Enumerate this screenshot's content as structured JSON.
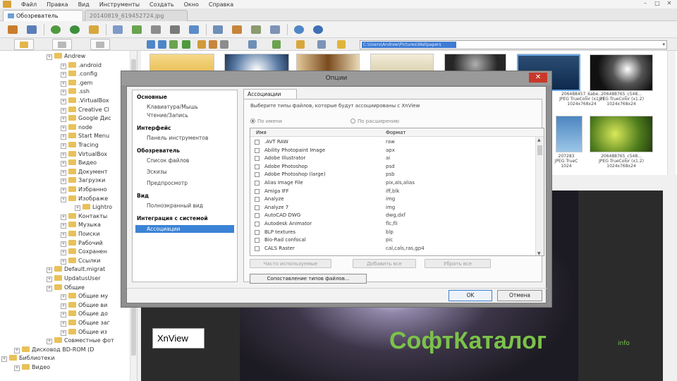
{
  "menubar": {
    "items": [
      "Файл",
      "Правка",
      "Вид",
      "Инструменты",
      "Создать",
      "Окно",
      "Справка"
    ],
    "window_buttons": [
      "–",
      "□",
      "✕"
    ]
  },
  "tabs": [
    {
      "label": "Обозреватель",
      "active": true
    },
    {
      "label": "20140819_619452724.jpg",
      "active": false
    }
  ],
  "address": {
    "value": "C:\\Users\\Andrew\\Pictures\\Wallpapers"
  },
  "tree": {
    "items": [
      {
        "label": "Andrew",
        "level": 0
      },
      {
        "label": ".android",
        "level": 1
      },
      {
        "label": ".config",
        "level": 1
      },
      {
        "label": ".gem",
        "level": 1
      },
      {
        "label": ".ssh",
        "level": 1
      },
      {
        "label": ".VirtualBox",
        "level": 1
      },
      {
        "label": "Creative Cl",
        "level": 1
      },
      {
        "label": "Google Дис",
        "level": 1
      },
      {
        "label": "node",
        "level": 1
      },
      {
        "label": "Start Menu",
        "level": 1
      },
      {
        "label": "Tracing",
        "level": 1
      },
      {
        "label": "VirtualBox",
        "level": 1
      },
      {
        "label": "Видео",
        "level": 1
      },
      {
        "label": "Документ",
        "level": 1
      },
      {
        "label": "Загрузки",
        "level": 1
      },
      {
        "label": "Избранно",
        "level": 1
      },
      {
        "label": "Изображе",
        "level": 1
      },
      {
        "label": "Lightro",
        "level": 2
      },
      {
        "label": "Контакты",
        "level": 1
      },
      {
        "label": "Музыка",
        "level": 1
      },
      {
        "label": "Поиски",
        "level": 1
      },
      {
        "label": "Рабочий",
        "level": 1
      },
      {
        "label": "Сохранен",
        "level": 1
      },
      {
        "label": "Ссылки",
        "level": 1
      },
      {
        "label": "Default.migrat",
        "level": 0
      },
      {
        "label": "UpdatusUser",
        "level": 0
      },
      {
        "label": "Общие",
        "level": 0
      },
      {
        "label": "Общие му",
        "level": 1
      },
      {
        "label": "Общие ви",
        "level": 1
      },
      {
        "label": "Общие до",
        "level": 1
      },
      {
        "label": "Общие заг",
        "level": 1
      },
      {
        "label": "Общие из",
        "level": 1
      },
      {
        "label": "Совместные фот",
        "level": 0
      },
      {
        "label": "Дисковод BD-ROM (D",
        "level": -1
      },
      {
        "label": "Библиотеки",
        "level": -2
      },
      {
        "label": "Видео",
        "level": -1
      }
    ]
  },
  "thumbnails": {
    "captions": [
      {
        "line1": "206488457_6abe...",
        "line2": "JPEG TrueColor (x1.2)",
        "line3": "1024x768x24"
      },
      {
        "line1": "206488765_c548...",
        "line2": "JPEG TrueColor (x1.2)",
        "line3": "1024x768x24"
      },
      {
        "line1": "207283",
        "line2": "JPEG TrueC",
        "line3": "1024"
      },
      {
        "line1": "20728",
        "line2": "JPEG TrueC",
        "line3": "1024"
      }
    ]
  },
  "dialog": {
    "title": "Опции",
    "close": "✕",
    "nav": [
      {
        "label": "Основные",
        "kind": "head"
      },
      {
        "label": "Клавиатура/Мышь",
        "kind": "sub"
      },
      {
        "label": "Чтение/Запись",
        "kind": "sub"
      },
      {
        "label": "Интерфейс",
        "kind": "head"
      },
      {
        "label": "Панель инструментов",
        "kind": "sub"
      },
      {
        "label": "Обозреватель",
        "kind": "head"
      },
      {
        "label": "Список файлов",
        "kind": "sub"
      },
      {
        "label": "Эскизы",
        "kind": "sub"
      },
      {
        "label": "Предпросмотр",
        "kind": "sub"
      },
      {
        "label": "Вид",
        "kind": "head"
      },
      {
        "label": "Полноэкранный вид",
        "kind": "sub"
      },
      {
        "label": "Интеграция с системой",
        "kind": "head"
      },
      {
        "label": "Ассоциации",
        "kind": "selected"
      }
    ],
    "tab_label": "Ассоциации",
    "hint": "Выберите типы файлов, которые будут ассоциированы с XnView",
    "radio_by_name": "По имени",
    "radio_by_ext": "По расширению",
    "col_name": "Имя",
    "col_format": "Формат",
    "rows": [
      {
        "name": ".AVT RAW",
        "format": "raw"
      },
      {
        "name": "Ability Photopaint Image",
        "format": "apx"
      },
      {
        "name": "Adobe Illustrator",
        "format": "ai"
      },
      {
        "name": "Adobe Photoshop",
        "format": "psd"
      },
      {
        "name": "Adobe Photoshop (large)",
        "format": "psb"
      },
      {
        "name": "Alias Image File",
        "format": "pix,als,alias"
      },
      {
        "name": "Amiga IFF",
        "format": "iff,blk"
      },
      {
        "name": "Analyze",
        "format": "img"
      },
      {
        "name": "Analyze 7",
        "format": "img"
      },
      {
        "name": "AutoCAD DWG",
        "format": "dwg,dxf"
      },
      {
        "name": "Autodesk Animator",
        "format": "flc,fli"
      },
      {
        "name": "BLP textures",
        "format": "blp"
      },
      {
        "name": "Bio-Rad confocal",
        "format": "pic"
      },
      {
        "name": "CALS Raster",
        "format": "cal,cals,ras,gp4"
      }
    ],
    "btn_frequent": "Часто используемые",
    "btn_add_all": "Добавить все",
    "btn_remove_all": "Убрать все",
    "btn_compare": "Сопоставление типов файлов...",
    "btn_ok": "OK",
    "btn_cancel": "Отмена"
  },
  "preview": {
    "brand": "СофтКаталог",
    "brand_suffix": "info"
  },
  "caption": {
    "text": "XnView"
  }
}
